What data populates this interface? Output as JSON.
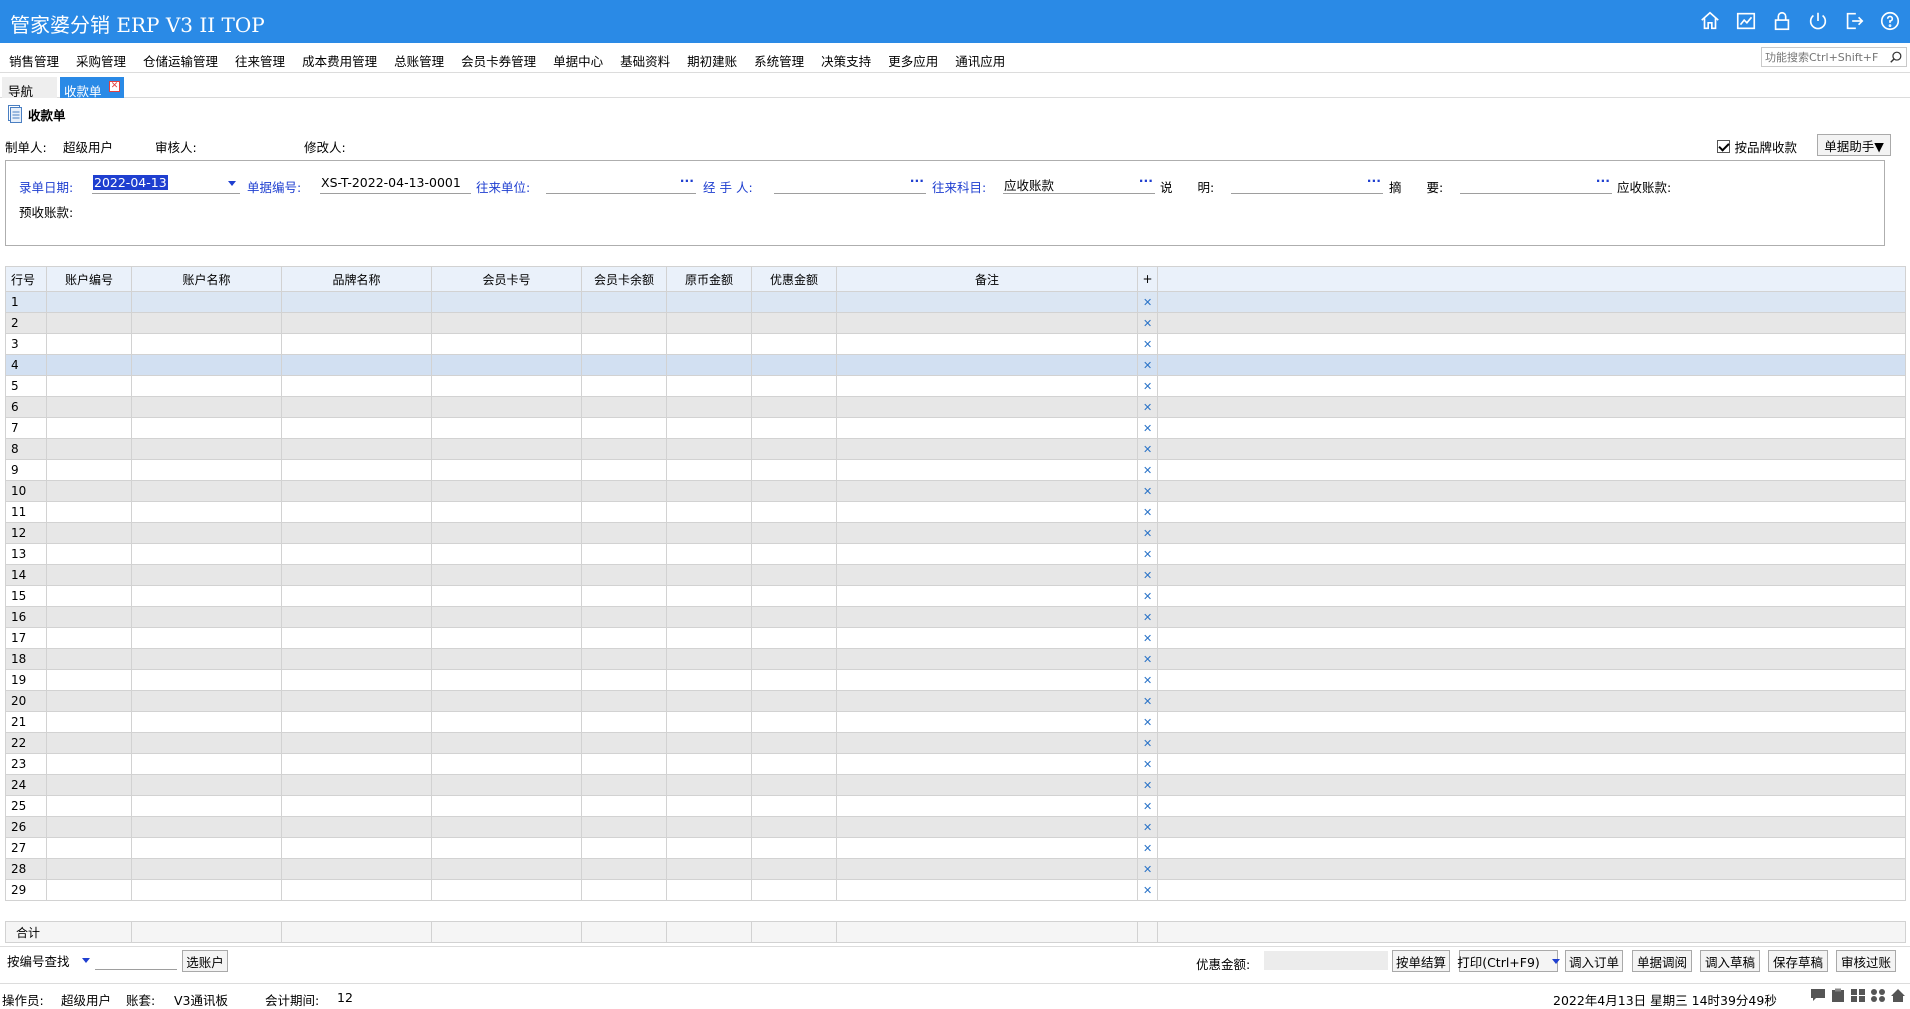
{
  "app": {
    "title": "管家婆分销 ERP V3 II TOP",
    "title_icons": [
      "home-icon",
      "chart-icon",
      "lock-icon",
      "power-icon",
      "exit-icon",
      "help-icon"
    ]
  },
  "menu": {
    "items": [
      "销售管理",
      "采购管理",
      "仓储运输管理",
      "往来管理",
      "成本费用管理",
      "总账管理",
      "会员卡券管理",
      "单据中心",
      "基础资料",
      "期初建账",
      "系统管理",
      "决策支持",
      "更多应用",
      "通讯应用"
    ],
    "search_placeholder": "功能搜索Ctrl+Shift+F"
  },
  "tabs": {
    "nav": "导航",
    "active": "收款单"
  },
  "doc": {
    "title": "收款单"
  },
  "meta": {
    "maker_label": "制单人:",
    "maker_value": "超级用户",
    "auditor_label": "审核人:",
    "modifier_label": "修改人:",
    "by_brand_label": "按品牌收款",
    "helper_button": "单据助手▼"
  },
  "header": {
    "date_label": "录单日期:",
    "date_value": "2022-04-13",
    "number_label": "单据编号:",
    "number_value": "XS-T-2022-04-13-0001",
    "unit_label": "往来单位:",
    "unit_value": "",
    "handler_label": "经 手 人:",
    "handler_value": "",
    "subject_label": "往来科目:",
    "subject_value": "应收账款",
    "desc_label": "说　　明:",
    "desc_value": "",
    "summary_label": "摘　　要:",
    "summary_value": "",
    "receivable_label": "应收账款:",
    "prepaid_label": "预收账款:",
    "dots": "···"
  },
  "grid": {
    "columns": [
      "行号",
      "账户编号",
      "账户名称",
      "品牌名称",
      "会员卡号",
      "会员卡余额",
      "原币金额",
      "优惠金额",
      "备注",
      "+"
    ],
    "rows": [
      "1",
      "2",
      "3",
      "4",
      "5",
      "6",
      "7",
      "8",
      "9",
      "10",
      "11",
      "12",
      "13",
      "14",
      "15",
      "16",
      "17",
      "18",
      "19",
      "20",
      "21",
      "22",
      "23",
      "24",
      "25",
      "26",
      "27",
      "28",
      "29"
    ],
    "total_label": "合计",
    "delete_glyph": "✕"
  },
  "bottom": {
    "search_mode": "按编号查找",
    "select_account": "选账户",
    "discount_label": "优惠金额:",
    "buttons": [
      "按单结算",
      "打印(Ctrl+F9)",
      "调入订单",
      "单据调阅",
      "调入草稿",
      "保存草稿",
      "审核过账"
    ]
  },
  "status": {
    "operator_label": "操作员:",
    "operator_value": "超级用户",
    "book_label": "账套:",
    "book_value": "V3通讯板",
    "period_label": "会计期间:",
    "period_value": "12",
    "datetime": "2022年4月13日 星期三 14时39分49秒"
  },
  "colors": {
    "accent": "#2a8ae6",
    "link": "#1f3fd0",
    "row_alt": "#e7e7e7",
    "row_selected": "#d2e0f2",
    "header_bg": "#eaf1fa"
  }
}
